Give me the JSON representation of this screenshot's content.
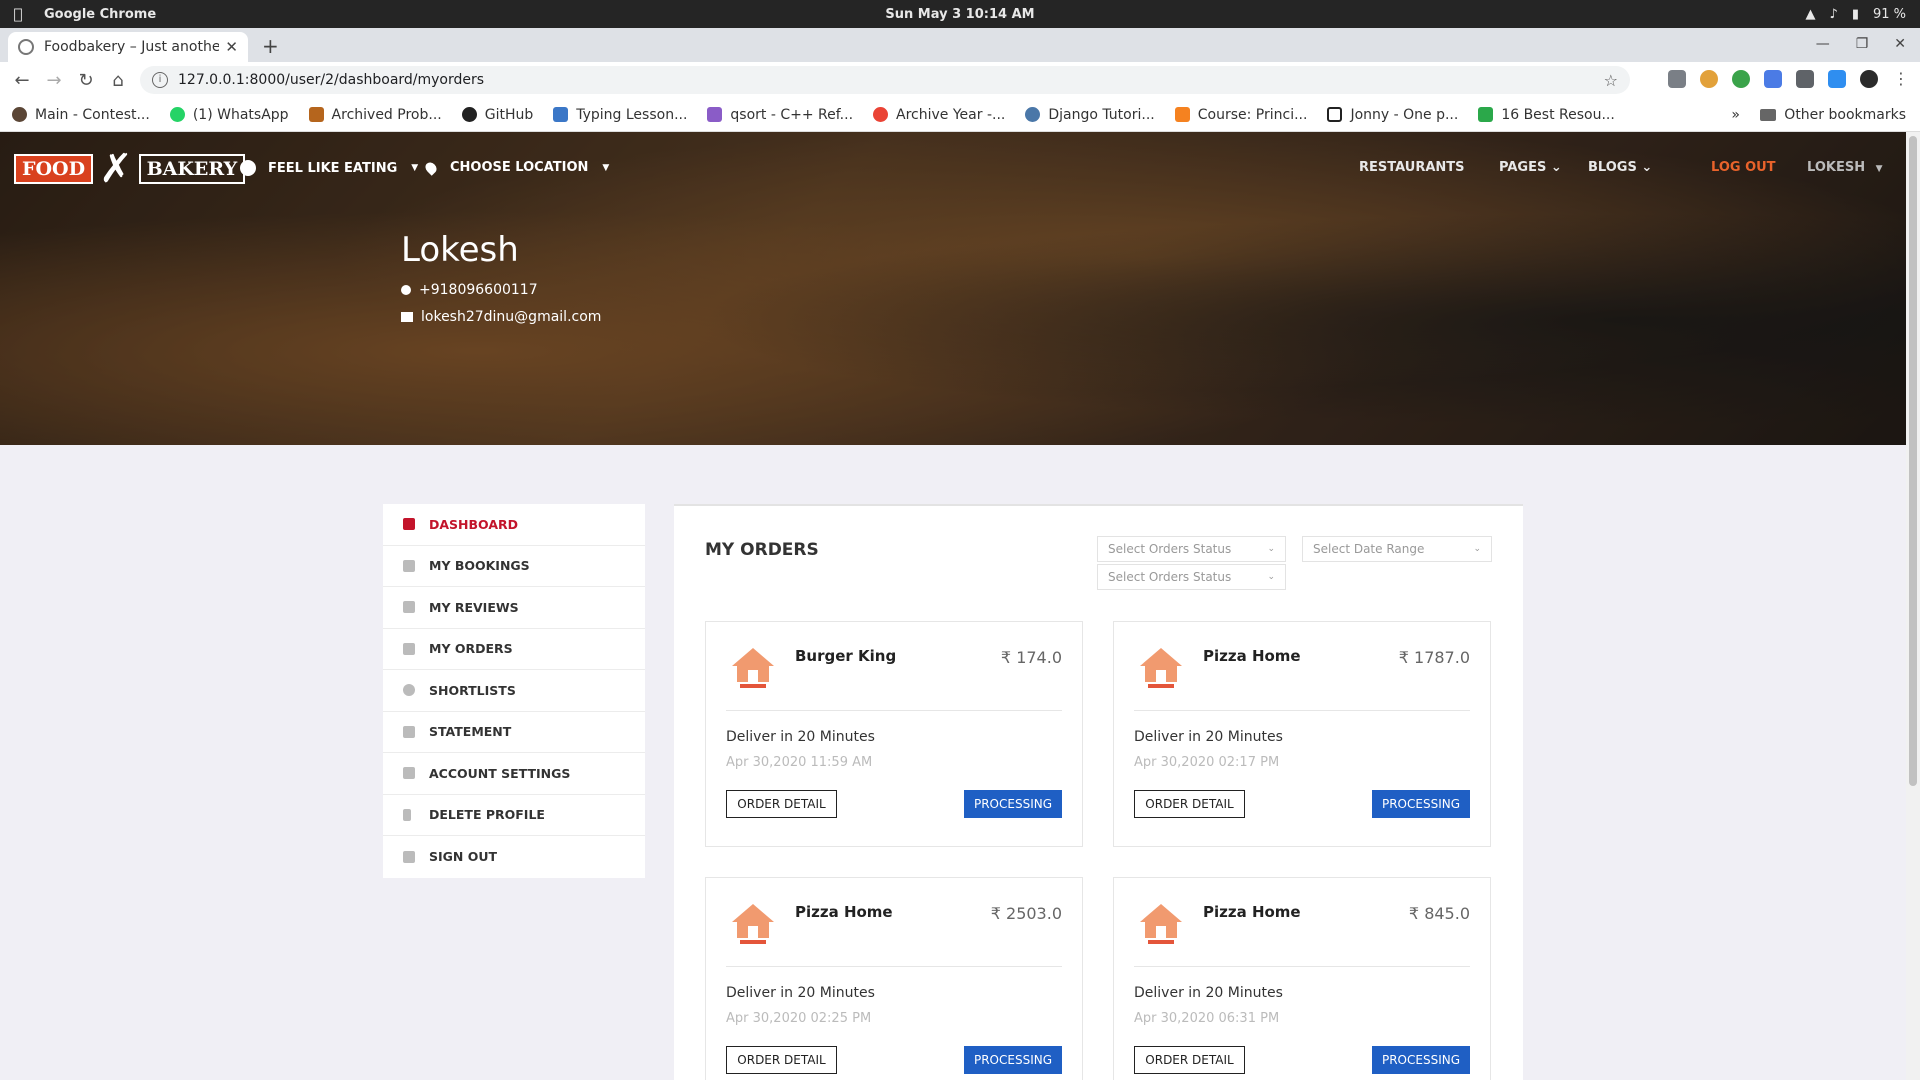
{
  "os": {
    "app_name": "Google Chrome",
    "clock": "Sun May 3  10:14 AM",
    "battery": "91 %"
  },
  "browser": {
    "tab_title": "Foodbakery – Just anothe",
    "url": "127.0.0.1:8000/user/2/dashboard/myorders",
    "bookmarks": [
      "Main - Contest...",
      "(1) WhatsApp",
      "Archived Prob...",
      "GitHub",
      "Typing Lesson...",
      "qsort - C++ Ref...",
      "Archive Year -...",
      "Django Tutori...",
      "Course: Princi...",
      "Jonny - One p...",
      "16 Best Resou..."
    ],
    "bookmarks_more": "»",
    "other_bookmarks": "Other bookmarks"
  },
  "site": {
    "logo_left": "FOOD",
    "logo_right": "BAKERY",
    "nav": {
      "feel_like_eating": "FEEL LIKE EATING",
      "choose_location": "CHOOSE LOCATION",
      "restaurants": "RESTAURANTS",
      "pages": "PAGES",
      "blogs": "BLOGS",
      "logout": "LOG OUT",
      "user": "LOKESH"
    },
    "profile": {
      "name": "Lokesh",
      "phone": "+918096600117",
      "email": "lokesh27dinu@gmail.com"
    }
  },
  "sidebar": {
    "items": [
      {
        "label": "DASHBOARD",
        "icon": "dashboard-icon"
      },
      {
        "label": "MY BOOKINGS",
        "icon": "bookings-icon"
      },
      {
        "label": "MY REVIEWS",
        "icon": "reviews-icon"
      },
      {
        "label": "MY ORDERS",
        "icon": "orders-icon"
      },
      {
        "label": "SHORTLISTS",
        "icon": "heart-icon"
      },
      {
        "label": "STATEMENT",
        "icon": "statement-icon"
      },
      {
        "label": "ACCOUNT SETTINGS",
        "icon": "wrench-icon"
      },
      {
        "label": "DELETE PROFILE",
        "icon": "trash-icon"
      },
      {
        "label": "SIGN OUT",
        "icon": "signout-icon"
      }
    ],
    "active_index": 0
  },
  "main": {
    "title": "MY ORDERS",
    "filters": {
      "status_1": "Select Orders Status",
      "status_2": "Select Orders Status",
      "date_range": "Select Date Range"
    },
    "orders": [
      {
        "restaurant": "Burger King",
        "price": "₹ 174.0",
        "deliver": "Deliver in 20 Minutes",
        "date": "Apr 30,2020 11:59 AM",
        "detail_label": "ORDER DETAIL",
        "status": "PROCESSING"
      },
      {
        "restaurant": "Pizza Home",
        "price": "₹ 1787.0",
        "deliver": "Deliver in 20 Minutes",
        "date": "Apr 30,2020 02:17 PM",
        "detail_label": "ORDER DETAIL",
        "status": "PROCESSING"
      },
      {
        "restaurant": "Pizza Home",
        "price": "₹ 2503.0",
        "deliver": "Deliver in 20 Minutes",
        "date": "Apr 30,2020 02:25 PM",
        "detail_label": "ORDER DETAIL",
        "status": "PROCESSING"
      },
      {
        "restaurant": "Pizza Home",
        "price": "₹ 845.0",
        "deliver": "Deliver in 20 Minutes",
        "date": "Apr 30,2020 06:31 PM",
        "detail_label": "ORDER DETAIL",
        "status": "PROCESSING"
      }
    ]
  },
  "colors": {
    "accent_red": "#c3142b",
    "status_blue": "#1f5fc4",
    "logout_orange": "#e9632b",
    "logo_orange": "#d9411e"
  }
}
